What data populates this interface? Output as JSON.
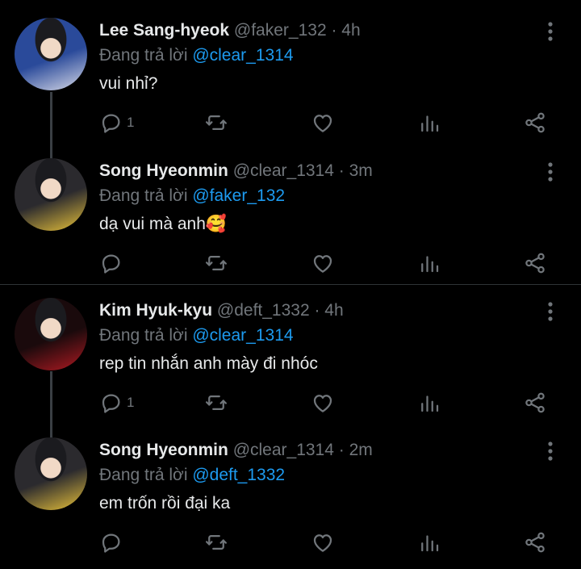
{
  "reply_prefix": "Đang trả lời",
  "tweets": [
    {
      "name": "Lee Sang-hyeok",
      "handle": "@faker_132",
      "time": "· 4h",
      "reply_to": "@clear_1314",
      "text": "vui nhỉ?",
      "reply_count": "1",
      "avatar_colors": [
        "#2a4a9a",
        "#d9dbe8"
      ]
    },
    {
      "name": "Song Hyeonmin",
      "handle": "@clear_1314",
      "time": "· 3m",
      "reply_to": "@faker_132",
      "text": "dạ vui mà anh🥰",
      "reply_count": "",
      "avatar_colors": [
        "#2b2a2e",
        "#e8c23a"
      ]
    },
    {
      "name": "Kim Hyuk-kyu",
      "handle": "@deft_1332",
      "time": "· 4h",
      "reply_to": "@clear_1314",
      "text": "rep tin nhắn anh mày đi nhóc",
      "reply_count": "1",
      "avatar_colors": [
        "#1a0a0c",
        "#b01a22"
      ]
    },
    {
      "name": "Song Hyeonmin",
      "handle": "@clear_1314",
      "time": "· 2m",
      "reply_to": "@deft_1332",
      "text": "em trốn rồi đại ka",
      "reply_count": "",
      "avatar_colors": [
        "#2b2a2e",
        "#e8c23a"
      ]
    }
  ],
  "colors": {
    "background": "#000000",
    "text": "#e7e9ea",
    "muted": "#71767b",
    "accent": "#1d9bf0"
  },
  "icons": [
    "reply-icon",
    "retweet-icon",
    "like-icon",
    "analytics-icon",
    "share-icon",
    "more-icon"
  ]
}
